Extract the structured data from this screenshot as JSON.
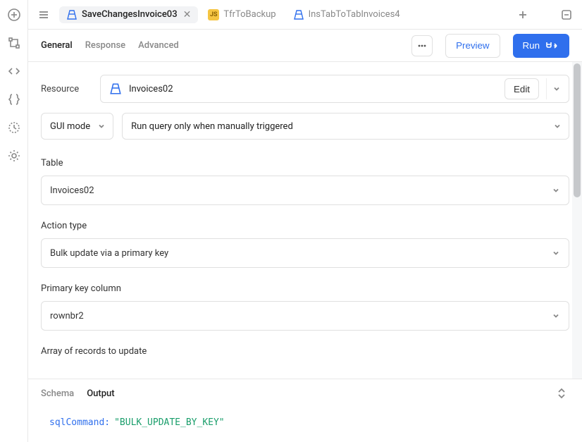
{
  "tabs": {
    "items": [
      {
        "label": "SaveChangesInvoice03",
        "icon": "db",
        "active": true,
        "closable": true
      },
      {
        "label": "TfrToBackup",
        "icon": "js",
        "active": false,
        "closable": false
      },
      {
        "label": "InsTabToTabInvoices4",
        "icon": "db",
        "active": false,
        "closable": false
      }
    ]
  },
  "subtabs": {
    "items": [
      {
        "label": "General",
        "active": true
      },
      {
        "label": "Response",
        "active": false
      },
      {
        "label": "Advanced",
        "active": false
      }
    ],
    "preview": "Preview",
    "run": "Run"
  },
  "resource": {
    "label": "Resource",
    "name": "Invoices02",
    "edit": "Edit"
  },
  "mode": {
    "value": "GUI mode",
    "trigger": "Run query only when manually triggered"
  },
  "fields": {
    "table_label": "Table",
    "table_value": "Invoices02",
    "action_label": "Action type",
    "action_value": "Bulk update via a primary key",
    "pk_label": "Primary key column",
    "pk_value": "rownbr2",
    "records_label": "Array of records to update"
  },
  "output": {
    "tabs": [
      {
        "label": "Schema",
        "active": false
      },
      {
        "label": "Output",
        "active": true
      }
    ],
    "key": "sqlCommand:",
    "value": "\"BULK_UPDATE_BY_KEY\""
  }
}
